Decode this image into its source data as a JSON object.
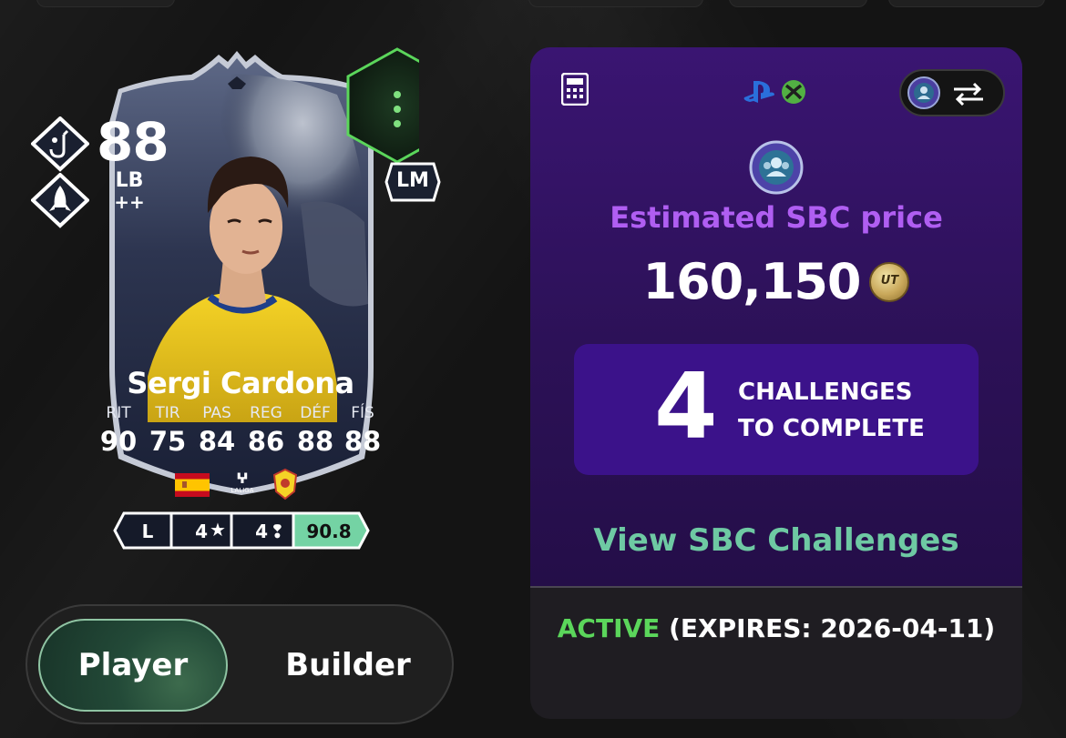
{
  "card": {
    "rating": "88",
    "position": "LB",
    "position_plus": "++",
    "alt_position": "LM",
    "name": "Sergi Cardona",
    "stats": [
      {
        "label": "RIT",
        "value": "90"
      },
      {
        "label": "TIR",
        "value": "75"
      },
      {
        "label": "PAS",
        "value": "84"
      },
      {
        "label": "REG",
        "value": "86"
      },
      {
        "label": "DÉF",
        "value": "88"
      },
      {
        "label": "FÍS",
        "value": "88"
      }
    ],
    "league_text": "LALIGA",
    "preferred_foot": "L",
    "skill_moves": "4",
    "weak_foot": "4",
    "score": "90.8",
    "score_color": "#74d3a4",
    "icons": [
      "playstyle-hook-icon",
      "playstyle-rocket-icon",
      "menu-dots-icon",
      "spain-flag-icon",
      "laliga-logo-icon",
      "villarreal-crest-icon"
    ]
  },
  "toggle": {
    "player_label": "Player",
    "builder_label": "Builder",
    "selected": "Player"
  },
  "panel": {
    "estimated_label": "Estimated SBC price",
    "price": "160,150",
    "coin_label": "UT",
    "challenges_count": "4",
    "challenges_line1": "CHALLENGES",
    "challenges_line2": "TO COMPLETE",
    "view_link": "View SBC Challenges",
    "status": "ACTIVE",
    "expires": "(EXPIRES: 2026-04-11)",
    "accent_color": "#b05ef2",
    "link_color": "#6ec9a3",
    "active_color": "#5bd65b",
    "icons": [
      "calculator-icon",
      "playstation-icon",
      "xbox-icon",
      "swap-icon",
      "sbc-crest-icon",
      "coin-icon"
    ]
  }
}
